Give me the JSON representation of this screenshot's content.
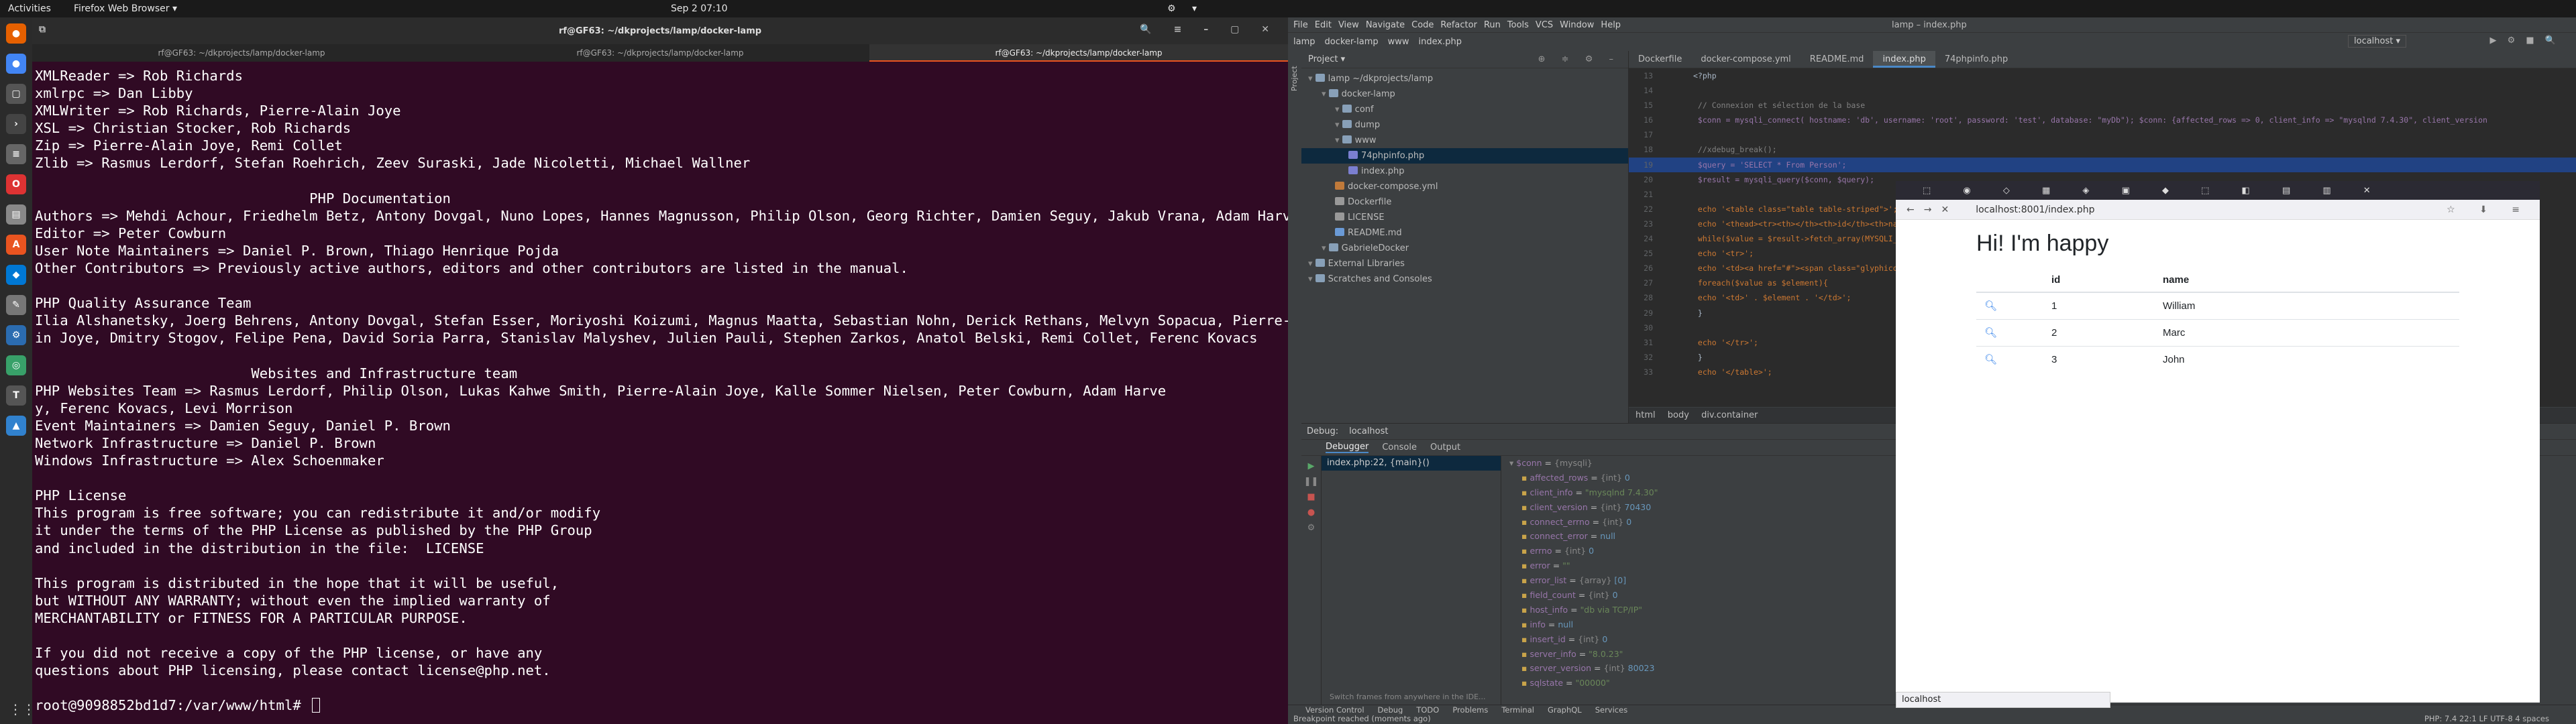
{
  "topbar": {
    "activities": "Activities",
    "app": "Firefox Web Browser ▾",
    "clock": "Sep 2  07:10"
  },
  "terminal": {
    "title": "rf@GF63: ~/dkprojects/lamp/docker-lamp",
    "tabs": [
      "rf@GF63: ~/dkprojects/lamp/docker-lamp",
      "rf@GF63: ~/dkprojects/lamp/docker-lamp",
      "rf@GF63: ~/dkprojects/lamp/docker-lamp"
    ],
    "lines": [
      "XMLReader => Rob Richards",
      "xmlrpc => Dan Libby",
      "XMLWriter => Rob Richards, Pierre-Alain Joye",
      "XSL => Christian Stocker, Rob Richards",
      "Zip => Pierre-Alain Joye, Remi Collet",
      "Zlib => Rasmus Lerdorf, Stefan Roehrich, Zeev Suraski, Jade Nicoletti, Michael Wallner",
      "",
      "                                 PHP Documentation",
      "Authors => Mehdi Achour, Friedhelm Betz, Antony Dovgal, Nuno Lopes, Hannes Magnusson, Philip Olson, Georg Richter, Damien Seguy, Jakub Vrana, Adam Harvey",
      "Editor => Peter Cowburn",
      "User Note Maintainers => Daniel P. Brown, Thiago Henrique Pojda",
      "Other Contributors => Previously active authors, editors and other contributors are listed in the manual.",
      "",
      "PHP Quality Assurance Team",
      "Ilia Alshanetsky, Joerg Behrens, Antony Dovgal, Stefan Esser, Moriyoshi Koizumi, Magnus Maatta, Sebastian Nohn, Derick Rethans, Melvyn Sopacua, Pierre-Ala",
      "in Joye, Dmitry Stogov, Felipe Pena, David Soria Parra, Stanislav Malyshev, Julien Pauli, Stephen Zarkos, Anatol Belski, Remi Collet, Ferenc Kovacs",
      "",
      "                          Websites and Infrastructure team",
      "PHP Websites Team => Rasmus Lerdorf, Philip Olson, Lukas Kahwe Smith, Pierre-Alain Joye, Kalle Sommer Nielsen, Peter Cowburn, Adam Harve",
      "y, Ferenc Kovacs, Levi Morrison",
      "Event Maintainers => Damien Seguy, Daniel P. Brown",
      "Network Infrastructure => Daniel P. Brown",
      "Windows Infrastructure => Alex Schoenmaker",
      "",
      "PHP License",
      "This program is free software; you can redistribute it and/or modify",
      "it under the terms of the PHP License as published by the PHP Group",
      "and included in the distribution in the file:  LICENSE",
      "",
      "This program is distributed in the hope that it will be useful,",
      "but WITHOUT ANY WARRANTY; without even the implied warranty of",
      "MERCHANTABILITY or FITNESS FOR A PARTICULAR PURPOSE.",
      "",
      "If you did not receive a copy of the PHP license, or have any",
      "questions about PHP licensing, please contact license@php.net.",
      "",
      "root@9098852bd1d7:/var/www/html# "
    ]
  },
  "ide": {
    "title": "lamp – index.php",
    "menu": [
      "File",
      "Edit",
      "View",
      "Navigate",
      "Code",
      "Refactor",
      "Run",
      "Tools",
      "VCS",
      "Window",
      "Help"
    ],
    "breadcrumbs": [
      "lamp",
      "docker-lamp",
      "www",
      "index.php"
    ],
    "run_config": "localhost ▾",
    "project_title": "Project ▾",
    "tree": [
      {
        "label": "lamp  ~/dkprojects/lamp",
        "type": "fold",
        "indent": 0
      },
      {
        "label": "docker-lamp",
        "type": "fold",
        "indent": 1
      },
      {
        "label": "conf",
        "type": "fold",
        "indent": 2
      },
      {
        "label": "dump",
        "type": "fold",
        "indent": 2
      },
      {
        "label": "www",
        "type": "fold",
        "indent": 2
      },
      {
        "label": "74phpinfo.php",
        "type": "php",
        "indent": 3,
        "selected": true
      },
      {
        "label": "index.php",
        "type": "php",
        "indent": 3
      },
      {
        "label": "docker-compose.yml",
        "type": "yml",
        "indent": 2
      },
      {
        "label": "Dockerfile",
        "type": "txt",
        "indent": 2
      },
      {
        "label": "LICENSE",
        "type": "txt",
        "indent": 2
      },
      {
        "label": "README.md",
        "type": "md",
        "indent": 2
      },
      {
        "label": "GabrieleDocker",
        "type": "fold",
        "indent": 1
      },
      {
        "label": "External Libraries",
        "type": "fold",
        "indent": 0
      },
      {
        "label": "Scratches and Consoles",
        "type": "fold",
        "indent": 0
      }
    ],
    "editor_tabs": [
      "Dockerfile",
      "docker-compose.yml",
      "README.md",
      "index.php",
      "74phpinfo.php"
    ],
    "active_tab": "index.php",
    "code": [
      {
        "no": "13",
        "text": "<?php"
      },
      {
        "no": "14",
        "text": ""
      },
      {
        "no": "15",
        "text": "    // Connexion et sélection de la base"
      },
      {
        "no": "16",
        "text": "    $conn = mysqli_connect( hostname: 'db',  username: 'root',  password: 'test',  database: \"myDb\");  $conn: {affected_rows => 0, client_info => \"mysqlnd 7.4.30\", client_version"
      },
      {
        "no": "17",
        "text": ""
      },
      {
        "no": "18",
        "text": "    //xdebug_break();"
      },
      {
        "no": "19",
        "text": "    $query = 'SELECT * From Person';"
      },
      {
        "no": "20",
        "text": "    $result = mysqli_query($conn, $query);"
      },
      {
        "no": "21",
        "text": ""
      },
      {
        "no": "22",
        "text": "    echo '<table class=\"table table-striped\">';"
      },
      {
        "no": "23",
        "text": "    echo '<thead><tr><th></th><th>id</th><th>name</th></tr></thead>';"
      },
      {
        "no": "24",
        "text": "    while($value = $result->fetch_array(MYSQLI_ASSOC)){"
      },
      {
        "no": "25",
        "text": "        echo '<tr>';"
      },
      {
        "no": "26",
        "text": "        echo '<td><a href=\"#\"><span class=\"glyphicon glyphicon-search\"></span></a></td>';"
      },
      {
        "no": "27",
        "text": "        foreach($value as $element){"
      },
      {
        "no": "28",
        "text": "            echo '<td>' . $element . '</td>';"
      },
      {
        "no": "29",
        "text": "        }"
      },
      {
        "no": "30",
        "text": ""
      },
      {
        "no": "31",
        "text": "        echo '</tr>';"
      },
      {
        "no": "32",
        "text": "    }"
      },
      {
        "no": "33",
        "text": "    echo '</table>';"
      }
    ],
    "code_highlight_line": "19",
    "code_crumbs": [
      "html",
      "body",
      "div.container"
    ],
    "debug": {
      "label": "Debug:",
      "config": "localhost",
      "tabs": [
        "Debugger",
        "Console",
        "Output"
      ],
      "frame": "index.php:22, {main}()",
      "frame_note": "Switch frames from anywhere in the IDE...",
      "vars": [
        {
          "name": "$conn",
          "type": "{mysqli}",
          "value": ""
        },
        {
          "name": "affected_rows",
          "type": "{int}",
          "value": "0"
        },
        {
          "name": "client_info",
          "type": "",
          "value": "\"mysqlnd 7.4.30\""
        },
        {
          "name": "client_version",
          "type": "{int}",
          "value": "70430"
        },
        {
          "name": "connect_errno",
          "type": "{int}",
          "value": "0"
        },
        {
          "name": "connect_error",
          "type": "",
          "value": "null"
        },
        {
          "name": "errno",
          "type": "{int}",
          "value": "0"
        },
        {
          "name": "error",
          "type": "",
          "value": "\"\""
        },
        {
          "name": "error_list",
          "type": "{array}",
          "value": "[0]"
        },
        {
          "name": "field_count",
          "type": "{int}",
          "value": "0"
        },
        {
          "name": "host_info",
          "type": "",
          "value": "\"db via TCP/IP\""
        },
        {
          "name": "info",
          "type": "",
          "value": "null"
        },
        {
          "name": "insert_id",
          "type": "{int}",
          "value": "0"
        },
        {
          "name": "server_info",
          "type": "",
          "value": "\"8.0.23\""
        },
        {
          "name": "server_version",
          "type": "{int}",
          "value": "80023"
        },
        {
          "name": "sqlstate",
          "type": "",
          "value": "\"00000\""
        }
      ]
    },
    "toolwindows": [
      "Version Control",
      "Debug",
      "TODO",
      "Problems",
      "Terminal",
      "GraphQL",
      "Services"
    ],
    "status_left": "Breakpoint reached (moments ago)",
    "status_right": "PHP: 7.4   22:1  LF  UTF-8  4 spaces"
  },
  "firefox": {
    "url": "localhost:8001/index.php",
    "heading": "Hi! I'm happy",
    "columns": [
      "",
      "id",
      "name"
    ],
    "rows": [
      {
        "id": "1",
        "name": "William"
      },
      {
        "id": "2",
        "name": "Marc"
      },
      {
        "id": "3",
        "name": "John"
      }
    ],
    "status": "localhost"
  }
}
